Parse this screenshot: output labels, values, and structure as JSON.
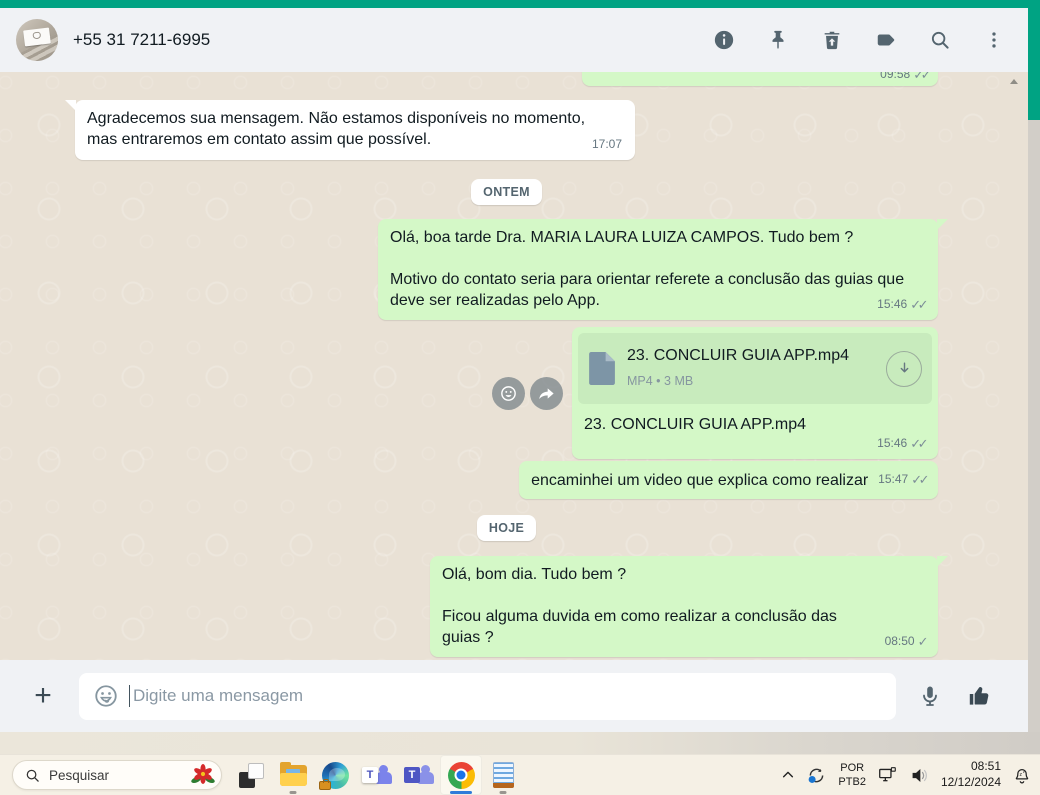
{
  "header": {
    "contact_name": "+55 31 7211-6995"
  },
  "chat": {
    "clipped": {
      "time": "09:58",
      "ticks": "✓✓"
    },
    "auto_reply": {
      "text": "Agradecemos sua mensagem. Não estamos disponíveis no momento, mas entraremos em contato assim que possível.",
      "time": "17:07"
    },
    "sep_yesterday": "ONTEM",
    "greeting": {
      "line1": "Olá, boa tarde Dra.  MARIA LAURA LUIZA CAMPOS. Tudo bem ?",
      "line2": "Motivo do contato seria para orientar referete a conclusão das guias que deve ser realizadas pelo App.",
      "time": "15:46",
      "ticks": "✓✓"
    },
    "file": {
      "filename": "23. CONCLUIR GUIA APP.mp4",
      "meta": "MP4 • 3 MB",
      "caption": "23. CONCLUIR GUIA APP.mp4",
      "time": "15:46",
      "ticks": "✓✓"
    },
    "video_note": {
      "text": "encaminhei um video que explica como realizar",
      "time": "15:47",
      "ticks": "✓✓"
    },
    "sep_today": "HOJE",
    "followup": {
      "line1": "Olá, bom dia. Tudo bem ?",
      "line2": "Ficou alguma duvida em como realizar a conclusão das guias ?",
      "time": "08:50",
      "ticks": "✓"
    }
  },
  "composer": {
    "placeholder": "Digite uma mensagem"
  },
  "taskbar": {
    "search_label": "Pesquisar",
    "teams_letter": "T",
    "tray": {
      "language_top": "POR",
      "language_bottom": "PTB2",
      "time": "08:51",
      "date": "12/12/2024"
    }
  },
  "colors": {
    "accent_teal": "#00a383",
    "outgoing_bubble": "#d4f8c7",
    "header_bg": "#f0f2f5",
    "chat_bg": "#e9e1d5",
    "taskbar_bg": "#f5f0e5",
    "chrome_active_underline": "#2f7bd9"
  }
}
